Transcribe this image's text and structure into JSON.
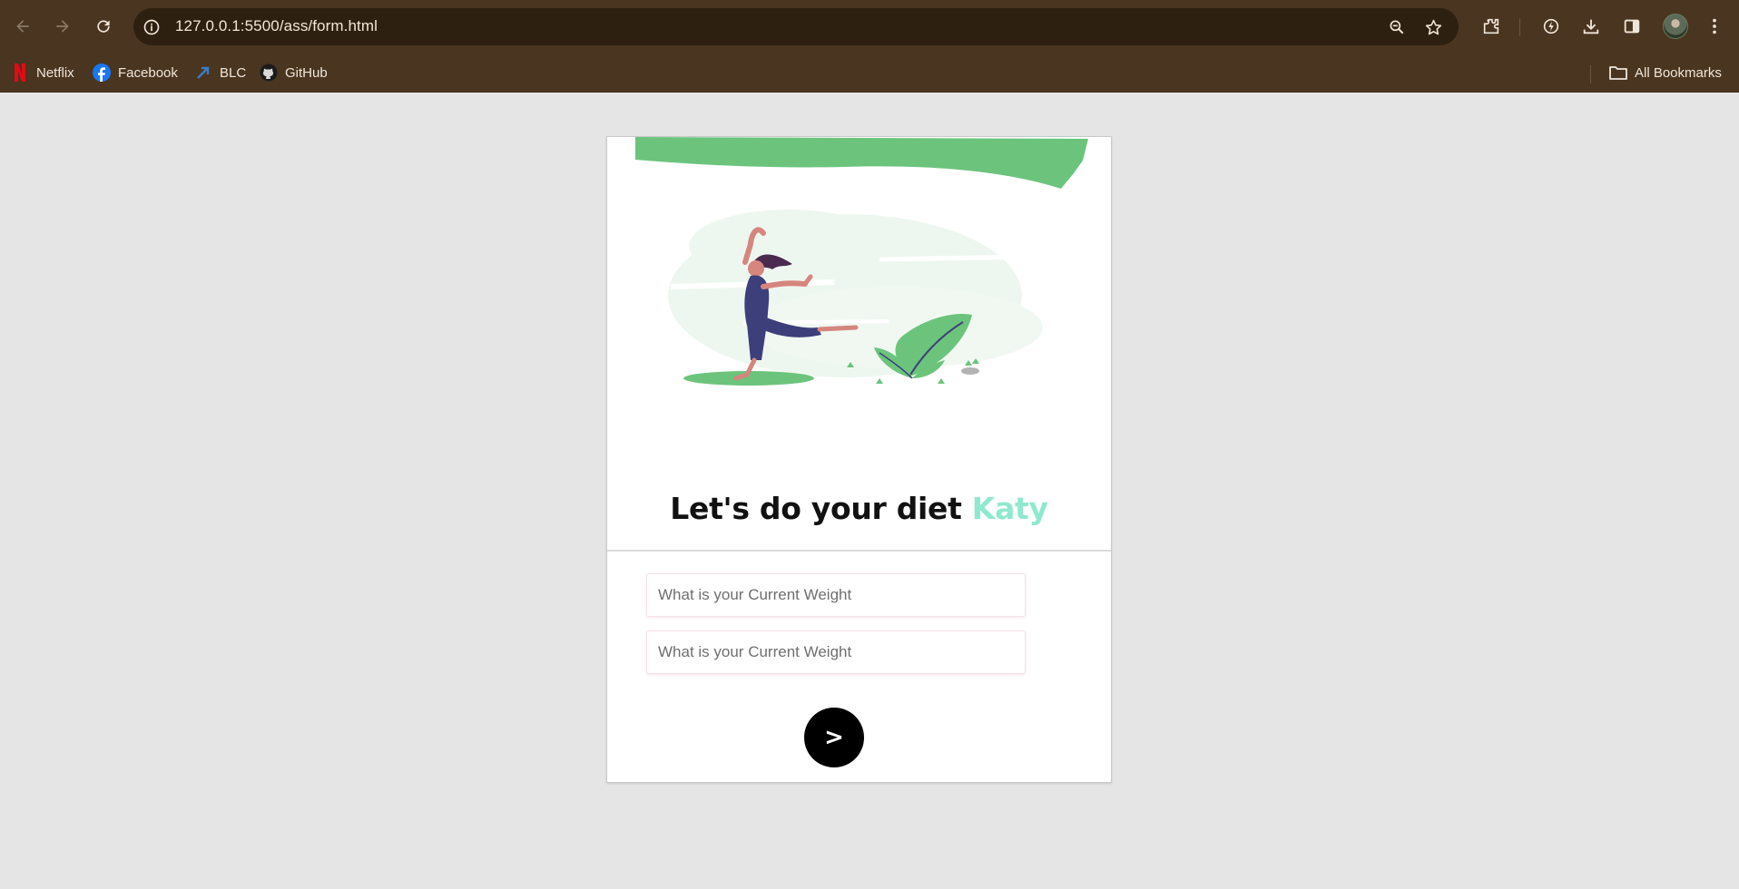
{
  "browser": {
    "url": "127.0.0.1:5500/ass/form.html",
    "bookmarks": [
      {
        "label": "Netflix",
        "icon": "netflix-icon"
      },
      {
        "label": "Facebook",
        "icon": "facebook-icon"
      },
      {
        "label": "BLC",
        "icon": "blc-icon"
      },
      {
        "label": "GitHub",
        "icon": "github-icon"
      }
    ],
    "all_bookmarks_label": "All Bookmarks"
  },
  "page": {
    "headline_prefix": "Let's do your diet ",
    "headline_name": "Katy",
    "fields": [
      {
        "placeholder": "What is your Current Weight",
        "value": ""
      },
      {
        "placeholder": "What is your Current Weight",
        "value": ""
      }
    ],
    "next_button_label": ">"
  },
  "colors": {
    "chrome": "#4a3520",
    "page_background": "#e6e5e5",
    "accent_name": "#8fe9cf",
    "illustration_green": "#6cc47c",
    "button": "#000000"
  }
}
